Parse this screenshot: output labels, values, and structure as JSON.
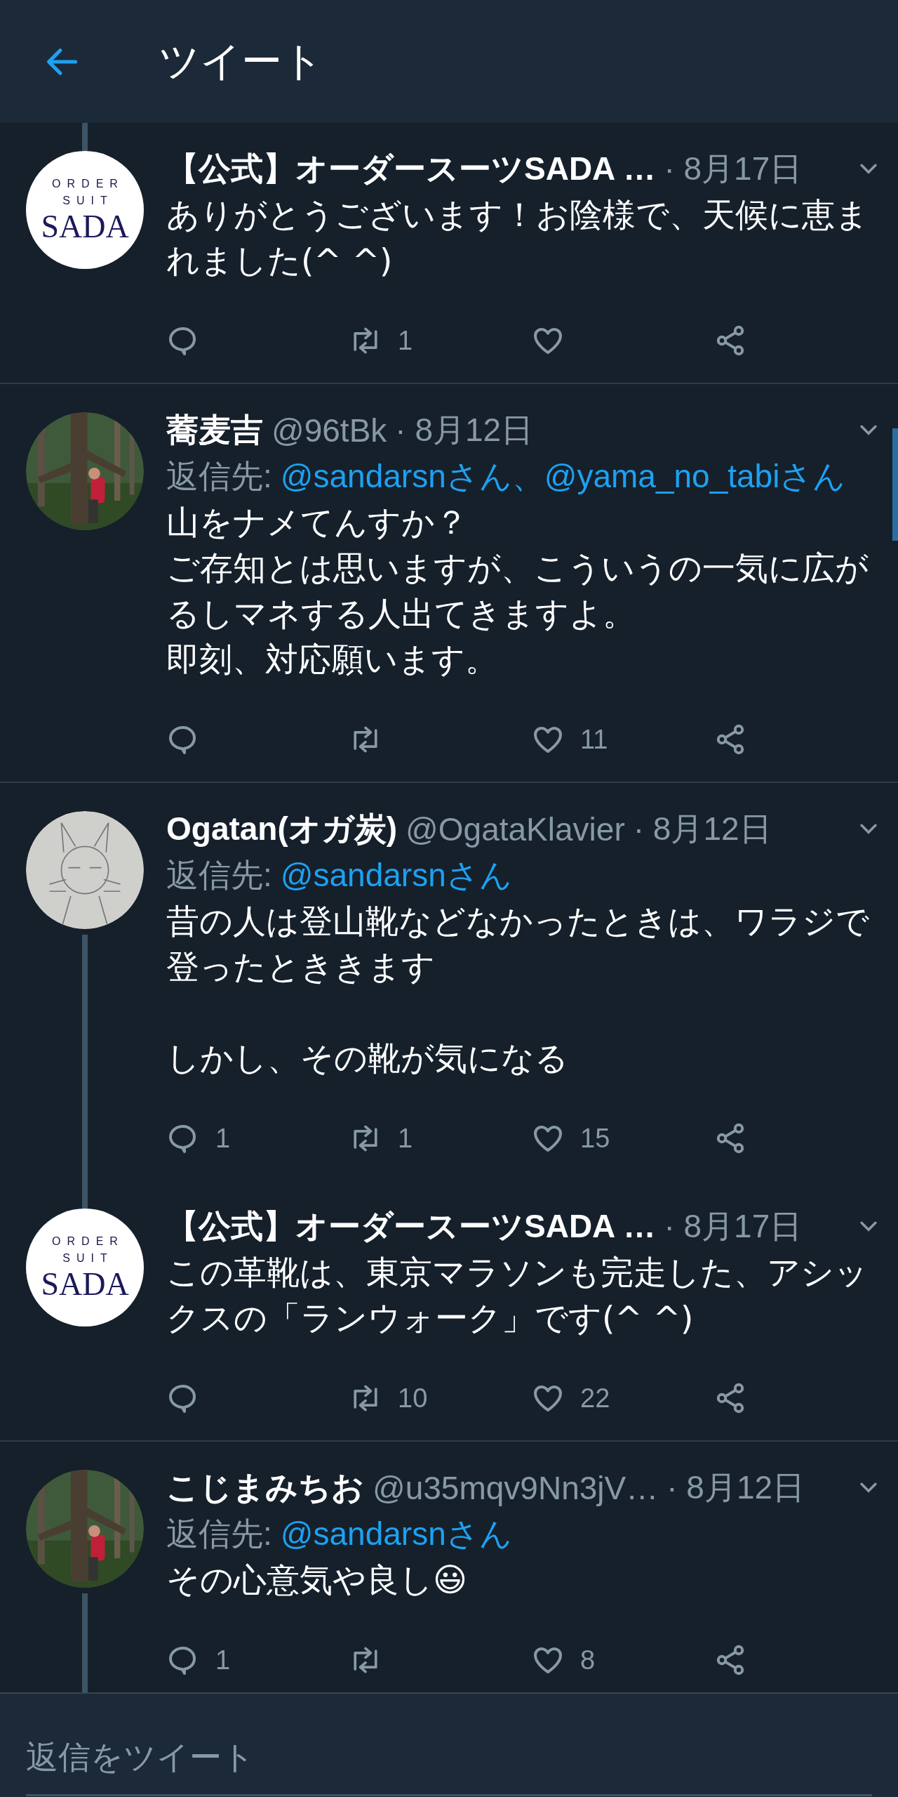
{
  "header": {
    "title": "ツイート"
  },
  "tweets": [
    {
      "avatar": {
        "kind": "logo",
        "lines": [
          "ORDER",
          "SUIT",
          "SADA"
        ]
      },
      "name": "【公式】オーダースーツSADA …",
      "date": "· 8月17日",
      "thread_above": true,
      "thread_below": false,
      "body": [
        [
          "ありがとうございます！お陰様で、天候に恵まれました(^ ^)"
        ]
      ],
      "actions": [
        {
          "kind": "reply"
        },
        {
          "kind": "retweet",
          "count": "1"
        },
        {
          "kind": "like"
        },
        {
          "kind": "share"
        }
      ]
    },
    {
      "avatar": {
        "kind": "picture"
      },
      "name": "蕎麦吉",
      "handle": "@96tBk",
      "date": "· 8月12日",
      "thread_above": false,
      "thread_below": false,
      "reply_to": {
        "label": "返信先:",
        "mentions": [
          "@sandarsnさん、",
          "@yama_no_tabiさん"
        ]
      },
      "body": [
        [
          "山をナメてんすか？",
          "ご存知とは思いますが、こういうの一気に広がるしマネする人出てきますよ。",
          "即刻、対応願います。"
        ]
      ],
      "actions": [
        {
          "kind": "reply"
        },
        {
          "kind": "retweet"
        },
        {
          "kind": "like",
          "count": "11"
        },
        {
          "kind": "share"
        }
      ]
    },
    {
      "avatar": {
        "kind": "picture"
      },
      "name": "Ogatan(オガ炭)",
      "handle": "@OgataKlavier",
      "date": "· 8月12日",
      "thread_above": false,
      "thread_below": true,
      "reply_to": {
        "label": "返信先:",
        "mentions": [
          "@sandarsnさん"
        ]
      },
      "body": [
        [
          "昔の人は登山靴などなかったときは、ワラジで登ったとききます"
        ],
        [
          "しかし、その靴が気になる"
        ]
      ],
      "actions": [
        {
          "kind": "reply",
          "count": "1"
        },
        {
          "kind": "retweet",
          "count": "1"
        },
        {
          "kind": "like",
          "count": "15"
        },
        {
          "kind": "share"
        }
      ]
    },
    {
      "avatar": {
        "kind": "logo",
        "lines": [
          "ORDER",
          "SUIT",
          "SADA"
        ]
      },
      "name": "【公式】オーダースーツSADA …",
      "date": "· 8月17日",
      "thread_above": true,
      "thread_below": false,
      "body": [
        [
          "この革靴は、東京マラソンも完走した、アシックスの「ランウォーク」です(^ ^)"
        ]
      ],
      "actions": [
        {
          "kind": "reply"
        },
        {
          "kind": "retweet",
          "count": "10"
        },
        {
          "kind": "like",
          "count": "22"
        },
        {
          "kind": "share"
        }
      ]
    },
    {
      "avatar": {
        "kind": "picture"
      },
      "name": "こじまみちお",
      "handle": "@u35mqv9Nn3jV…",
      "date": "· 8月12日",
      "thread_above": false,
      "thread_below": true,
      "reply_to": {
        "label": "返信先:",
        "mentions": [
          "@sandarsnさん"
        ]
      },
      "body": [
        [
          "その心意気や良し😃"
        ]
      ],
      "actions": [
        {
          "kind": "reply",
          "count": "1"
        },
        {
          "kind": "retweet"
        },
        {
          "kind": "like",
          "count": "8"
        },
        {
          "kind": "share"
        }
      ]
    }
  ],
  "reply_box": {
    "placeholder": "返信をツイート"
  }
}
